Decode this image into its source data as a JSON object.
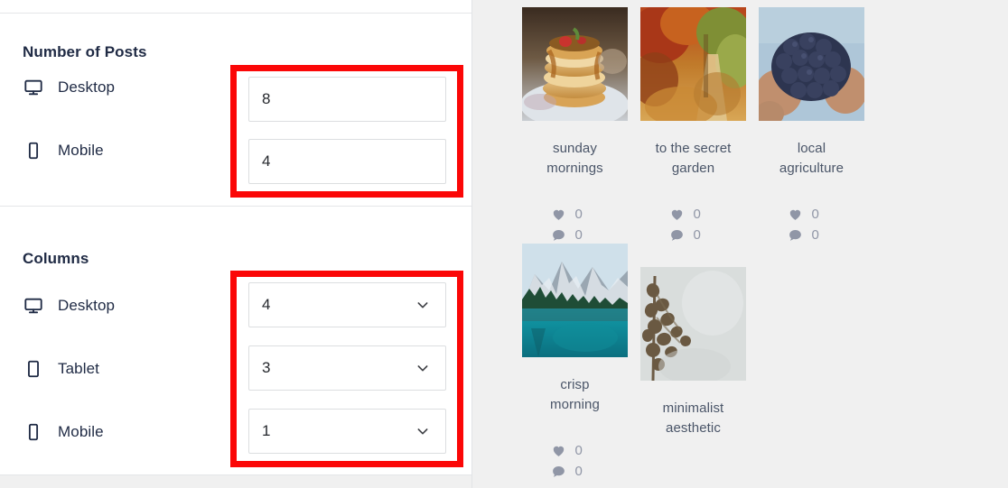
{
  "settings": {
    "sections": [
      {
        "id": "number-of-posts",
        "title": "Number of Posts",
        "control_type": "number-input",
        "rows": [
          {
            "icon": "desktop-icon",
            "label": "Desktop",
            "value": "8"
          },
          {
            "icon": "mobile-icon",
            "label": "Mobile",
            "value": "4"
          }
        ]
      },
      {
        "id": "columns",
        "title": "Columns",
        "control_type": "select",
        "rows": [
          {
            "icon": "desktop-icon",
            "label": "Desktop",
            "value": "4"
          },
          {
            "icon": "tablet-icon",
            "label": "Tablet",
            "value": "3"
          },
          {
            "icon": "mobile-icon",
            "label": "Mobile",
            "value": "1"
          }
        ]
      }
    ],
    "annotation_color": "#fb0707",
    "text_color": "#1f2a44"
  },
  "preview": {
    "background_color": "#f0f0f0",
    "meta_color": "#9096a6",
    "title_color": "#4a5568",
    "posts": [
      {
        "title": "sunday mornings",
        "image_alt": "pancake-stack-photo",
        "likes": "0",
        "comments": "0",
        "like_icon": "heart-icon",
        "comment_icon": "comment-icon"
      },
      {
        "title": "to the secret garden",
        "image_alt": "autumn-forest-path-photo",
        "likes": "0",
        "comments": "0",
        "like_icon": "heart-icon",
        "comment_icon": "comment-icon"
      },
      {
        "title": "local agriculture",
        "image_alt": "hands-holding-grapes-photo",
        "likes": "0",
        "comments": "0",
        "like_icon": "heart-icon",
        "comment_icon": "comment-icon"
      },
      {
        "title": "crisp morning",
        "image_alt": "mountain-lake-photo",
        "likes": "0",
        "comments": "0",
        "like_icon": "heart-icon",
        "comment_icon": "comment-icon"
      },
      {
        "title": "minimalist aesthetic",
        "image_alt": "dried-branch-on-snow-photo",
        "likes": "",
        "comments": "",
        "like_icon": "heart-icon",
        "comment_icon": "comment-icon"
      }
    ]
  }
}
